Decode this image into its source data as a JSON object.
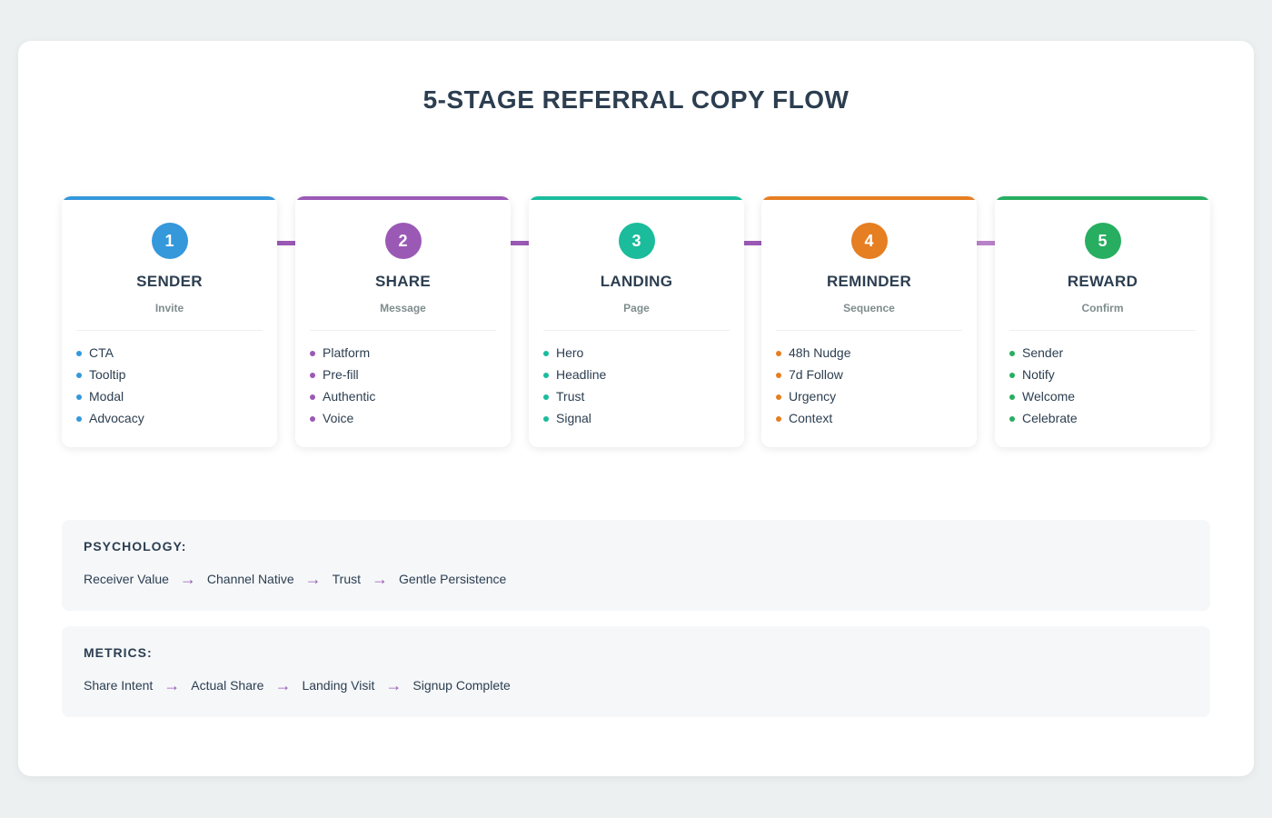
{
  "title": "5-STAGE REFERRAL COPY FLOW",
  "stages": [
    {
      "num": "1",
      "title": "SENDER",
      "sub": "Invite",
      "color": "#3498db",
      "items": [
        "CTA",
        "Tooltip",
        "Modal",
        "Advocacy"
      ]
    },
    {
      "num": "2",
      "title": "SHARE",
      "sub": "Message",
      "color": "#9b59b6",
      "items": [
        "Platform",
        "Pre-fill",
        "Authentic",
        "Voice"
      ]
    },
    {
      "num": "3",
      "title": "LANDING",
      "sub": "Page",
      "color": "#1abc9c",
      "items": [
        "Hero",
        "Headline",
        "Trust",
        "Signal"
      ]
    },
    {
      "num": "4",
      "title": "REMINDER",
      "sub": "Sequence",
      "color": "#e67e22",
      "items": [
        "48h Nudge",
        "7d Follow",
        "Urgency",
        "Context"
      ]
    },
    {
      "num": "5",
      "title": "REWARD",
      "sub": "Confirm",
      "color": "#27ae60",
      "items": [
        "Sender",
        "Notify",
        "Welcome",
        "Celebrate"
      ]
    }
  ],
  "connector_color": "#9b59b6",
  "psychology": {
    "heading": "PSYCHOLOGY:",
    "steps": [
      "Receiver Value",
      "Channel Native",
      "Trust",
      "Gentle Persistence"
    ]
  },
  "metrics": {
    "heading": "METRICS:",
    "steps": [
      "Share Intent",
      "Actual Share",
      "Landing Visit",
      "Signup Complete"
    ]
  },
  "arrow_glyph": "→"
}
